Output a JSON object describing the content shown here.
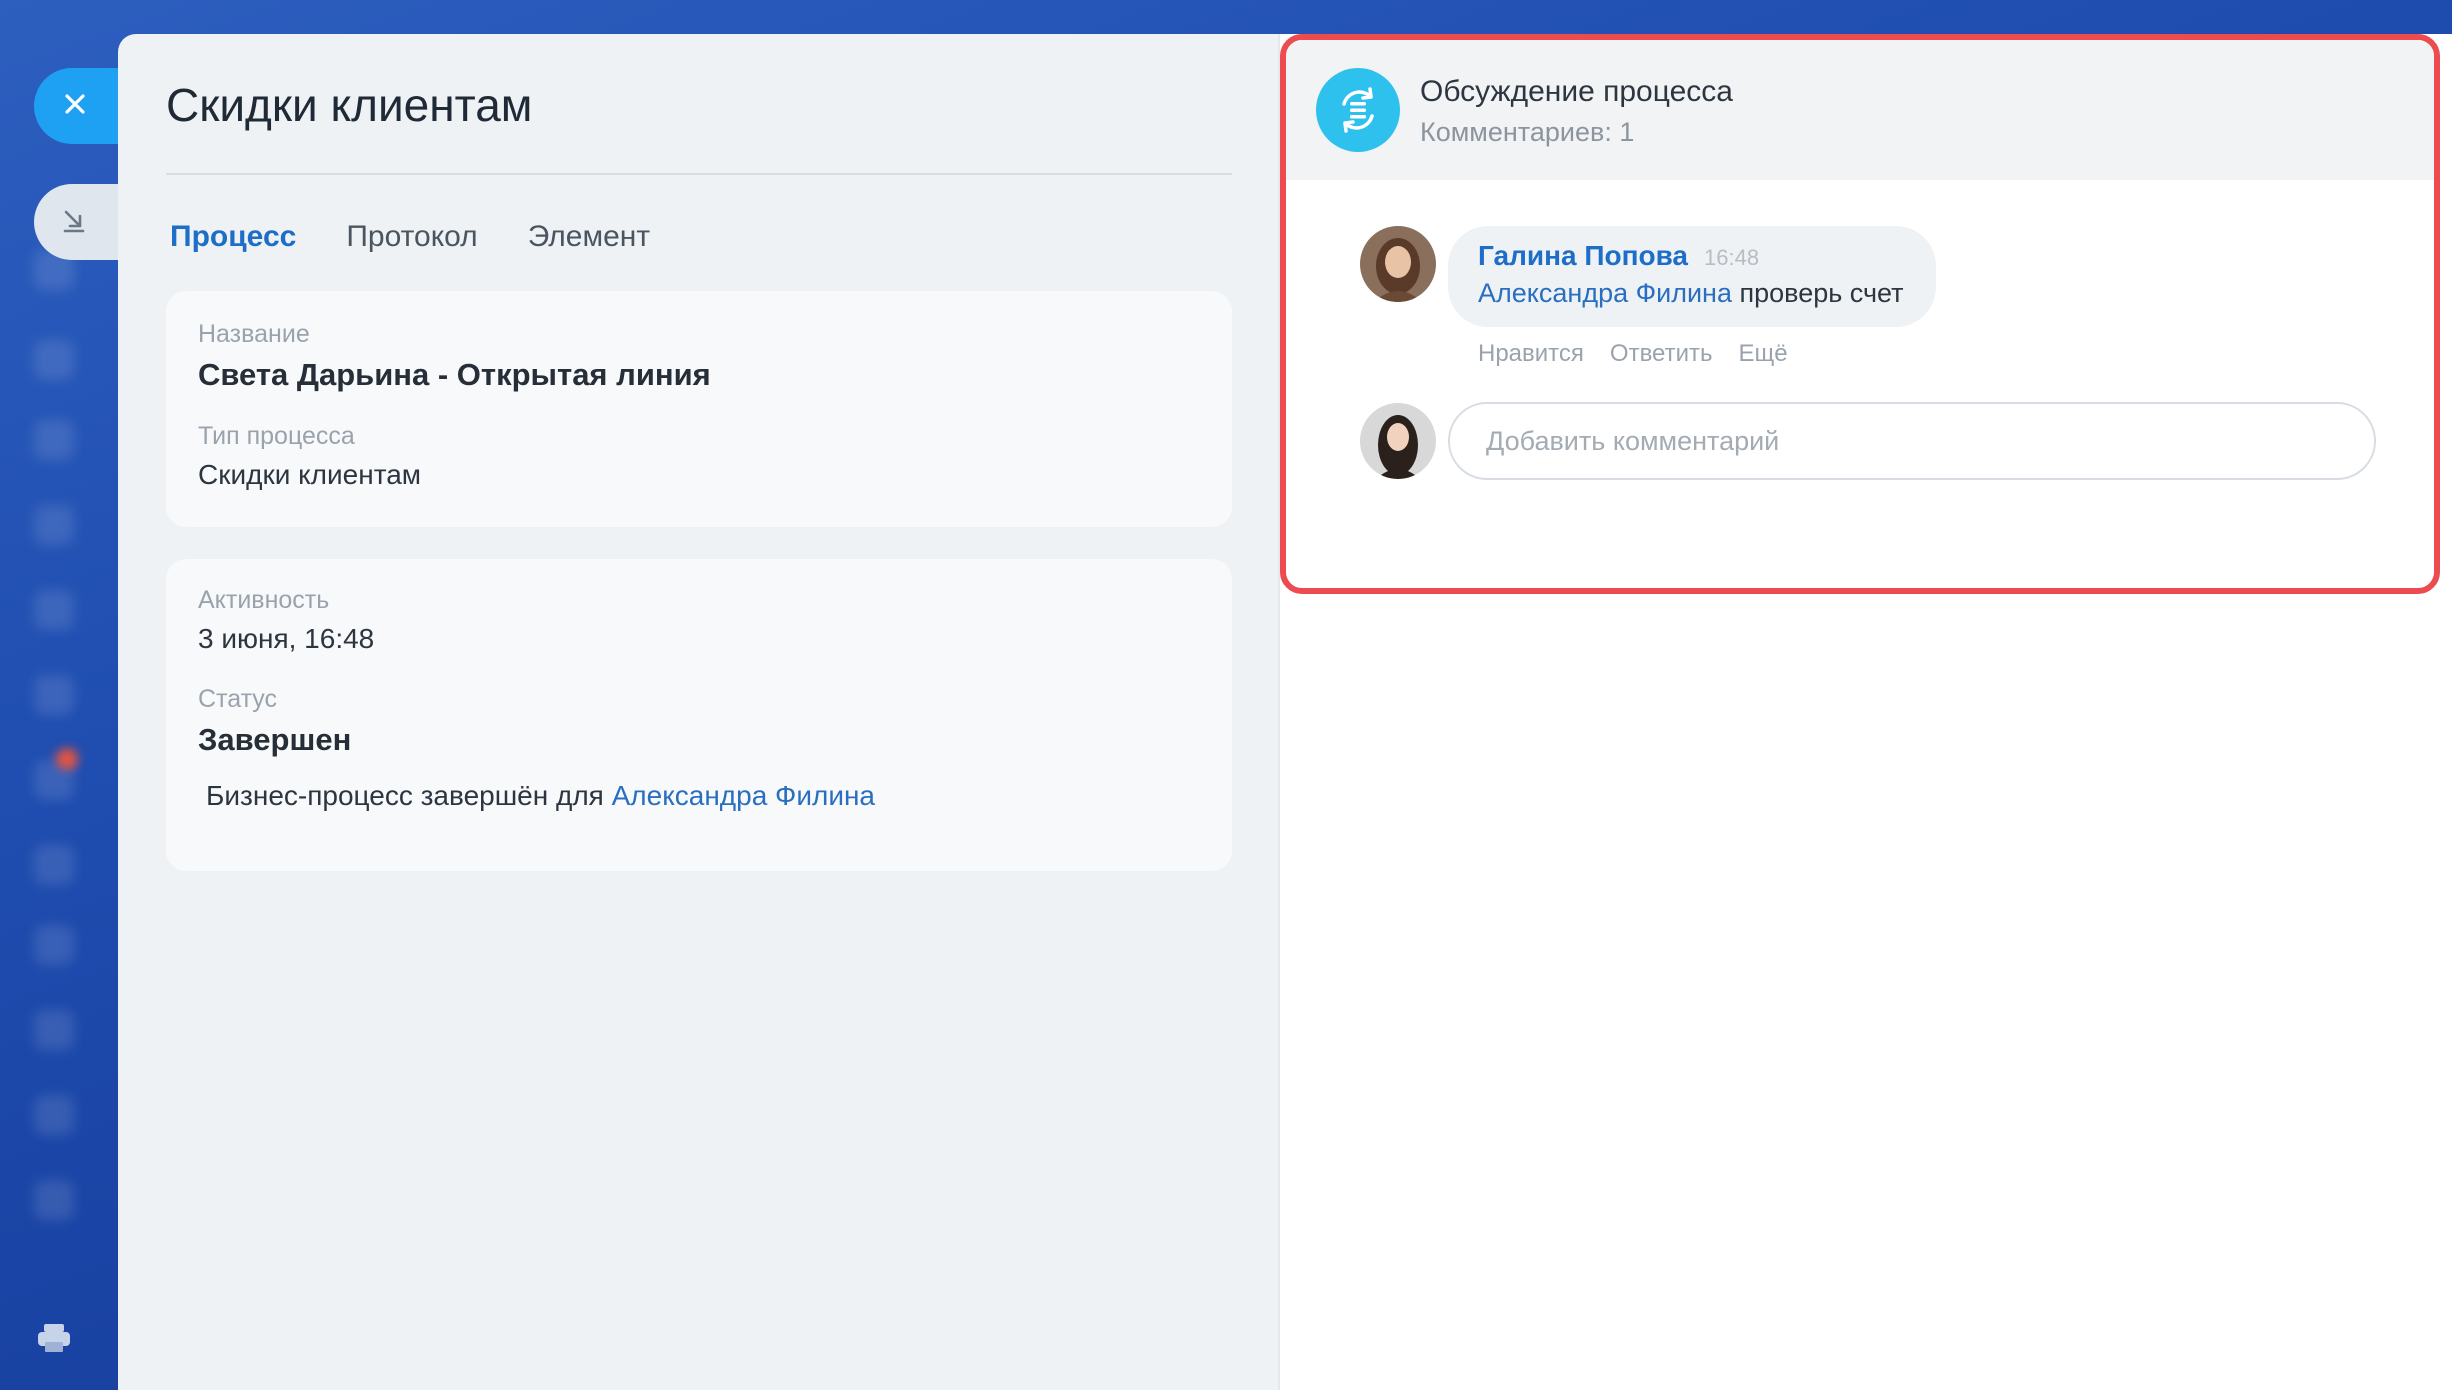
{
  "panel": {
    "title": "Скидки клиентам",
    "tabs": [
      {
        "label": "Процесс",
        "active": true
      },
      {
        "label": "Протокол",
        "active": false
      },
      {
        "label": "Элемент",
        "active": false
      }
    ]
  },
  "info_card": {
    "name_label": "Название",
    "name_value": "Света Дарьина - Открытая линия",
    "type_label": "Тип процесса",
    "type_value": "Скидки клиентам"
  },
  "status_card": {
    "activity_label": "Активность",
    "activity_value": "3 июня, 16:48",
    "status_label": "Статус",
    "status_value": "Завершен",
    "note_prefix": "Бизнес-процесс завершён для",
    "note_link": "Александра Филина"
  },
  "discussion": {
    "title": "Обсуждение процесса",
    "count_text": "Комментариев: 1",
    "comment": {
      "author": "Галина Попова",
      "time": "16:48",
      "mention": "Александра Филина",
      "text": "проверь счет",
      "actions": [
        "Нравится",
        "Ответить",
        "Ещё"
      ]
    },
    "input_placeholder": "Добавить комментарий"
  },
  "colors": {
    "accent": "#1e6ec8",
    "highlight_border": "#ec4b4f",
    "process_icon": "#2fc1ee",
    "close_button": "#1ea1f2"
  },
  "icons": {
    "close": "close-icon",
    "minimize": "minimize-icon",
    "process": "process-icon",
    "print": "print-icon"
  }
}
